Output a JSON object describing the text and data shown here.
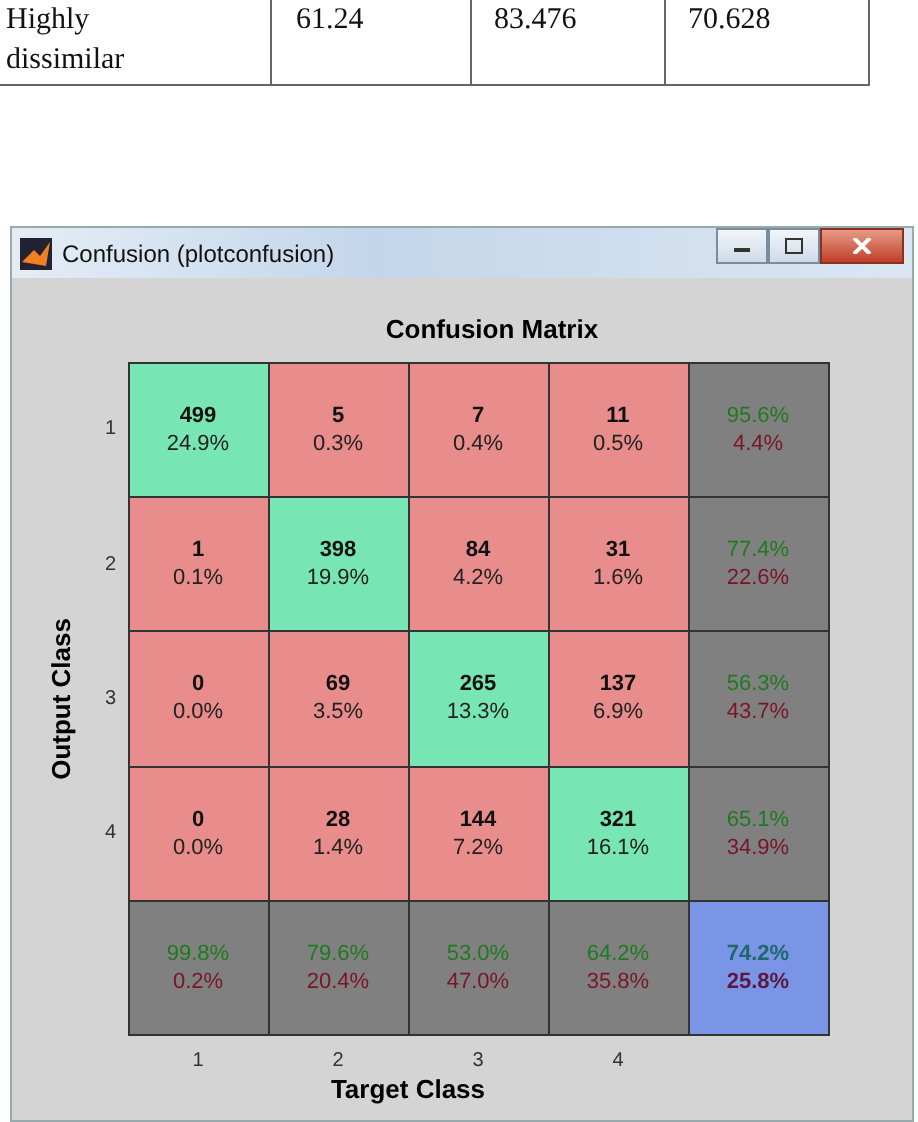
{
  "table": {
    "rows": [
      [
        "Highly dissimilar",
        "61.24",
        "83.476",
        "70.628"
      ]
    ]
  },
  "window": {
    "title": "Confusion (plotconfusion)",
    "buttons": [
      {
        "kind": "minimize"
      },
      {
        "kind": "maximize"
      },
      {
        "kind": "close"
      }
    ]
  },
  "plot": {
    "title": "Confusion Matrix",
    "ylabel": "Output Class",
    "xlabel": "Target Class",
    "row_labels": [
      "1",
      "2",
      "3",
      "4"
    ],
    "column_labels": [
      "1",
      "2",
      "3",
      "4"
    ],
    "cells": [
      [
        {
          "kind": "correct",
          "count": "499",
          "percent": "24.9%"
        },
        {
          "kind": "wrong",
          "count": "5",
          "percent": "0.3%"
        },
        {
          "kind": "wrong",
          "count": "7",
          "percent": "0.4%"
        },
        {
          "kind": "wrong",
          "count": "11",
          "percent": "0.5%"
        },
        {
          "kind": "summary",
          "good": "95.6%",
          "bad": "4.4%"
        }
      ],
      [
        {
          "kind": "wrong",
          "count": "1",
          "percent": "0.1%"
        },
        {
          "kind": "correct",
          "count": "398",
          "percent": "19.9%"
        },
        {
          "kind": "wrong",
          "count": "84",
          "percent": "4.2%"
        },
        {
          "kind": "wrong",
          "count": "31",
          "percent": "1.6%"
        },
        {
          "kind": "summary",
          "good": "77.4%",
          "bad": "22.6%"
        }
      ],
      [
        {
          "kind": "wrong",
          "count": "0",
          "percent": "0.0%"
        },
        {
          "kind": "wrong",
          "count": "69",
          "percent": "3.5%"
        },
        {
          "kind": "correct",
          "count": "265",
          "percent": "13.3%"
        },
        {
          "kind": "wrong",
          "count": "137",
          "percent": "6.9%"
        },
        {
          "kind": "summary",
          "good": "56.3%",
          "bad": "43.7%"
        }
      ],
      [
        {
          "kind": "wrong",
          "count": "0",
          "percent": "0.0%"
        },
        {
          "kind": "wrong",
          "count": "28",
          "percent": "1.4%"
        },
        {
          "kind": "wrong",
          "count": "144",
          "percent": "7.2%"
        },
        {
          "kind": "correct",
          "count": "321",
          "percent": "16.1%"
        },
        {
          "kind": "summary",
          "good": "65.1%",
          "bad": "34.9%"
        }
      ],
      [
        {
          "kind": "summary",
          "good": "99.8%",
          "bad": "0.2%"
        },
        {
          "kind": "summary",
          "good": "79.6%",
          "bad": "20.4%"
        },
        {
          "kind": "summary",
          "good": "53.0%",
          "bad": "47.0%"
        },
        {
          "kind": "summary",
          "good": "64.2%",
          "bad": "35.8%"
        },
        {
          "kind": "total",
          "good": "74.2%",
          "bad": "25.8%"
        }
      ]
    ]
  }
}
